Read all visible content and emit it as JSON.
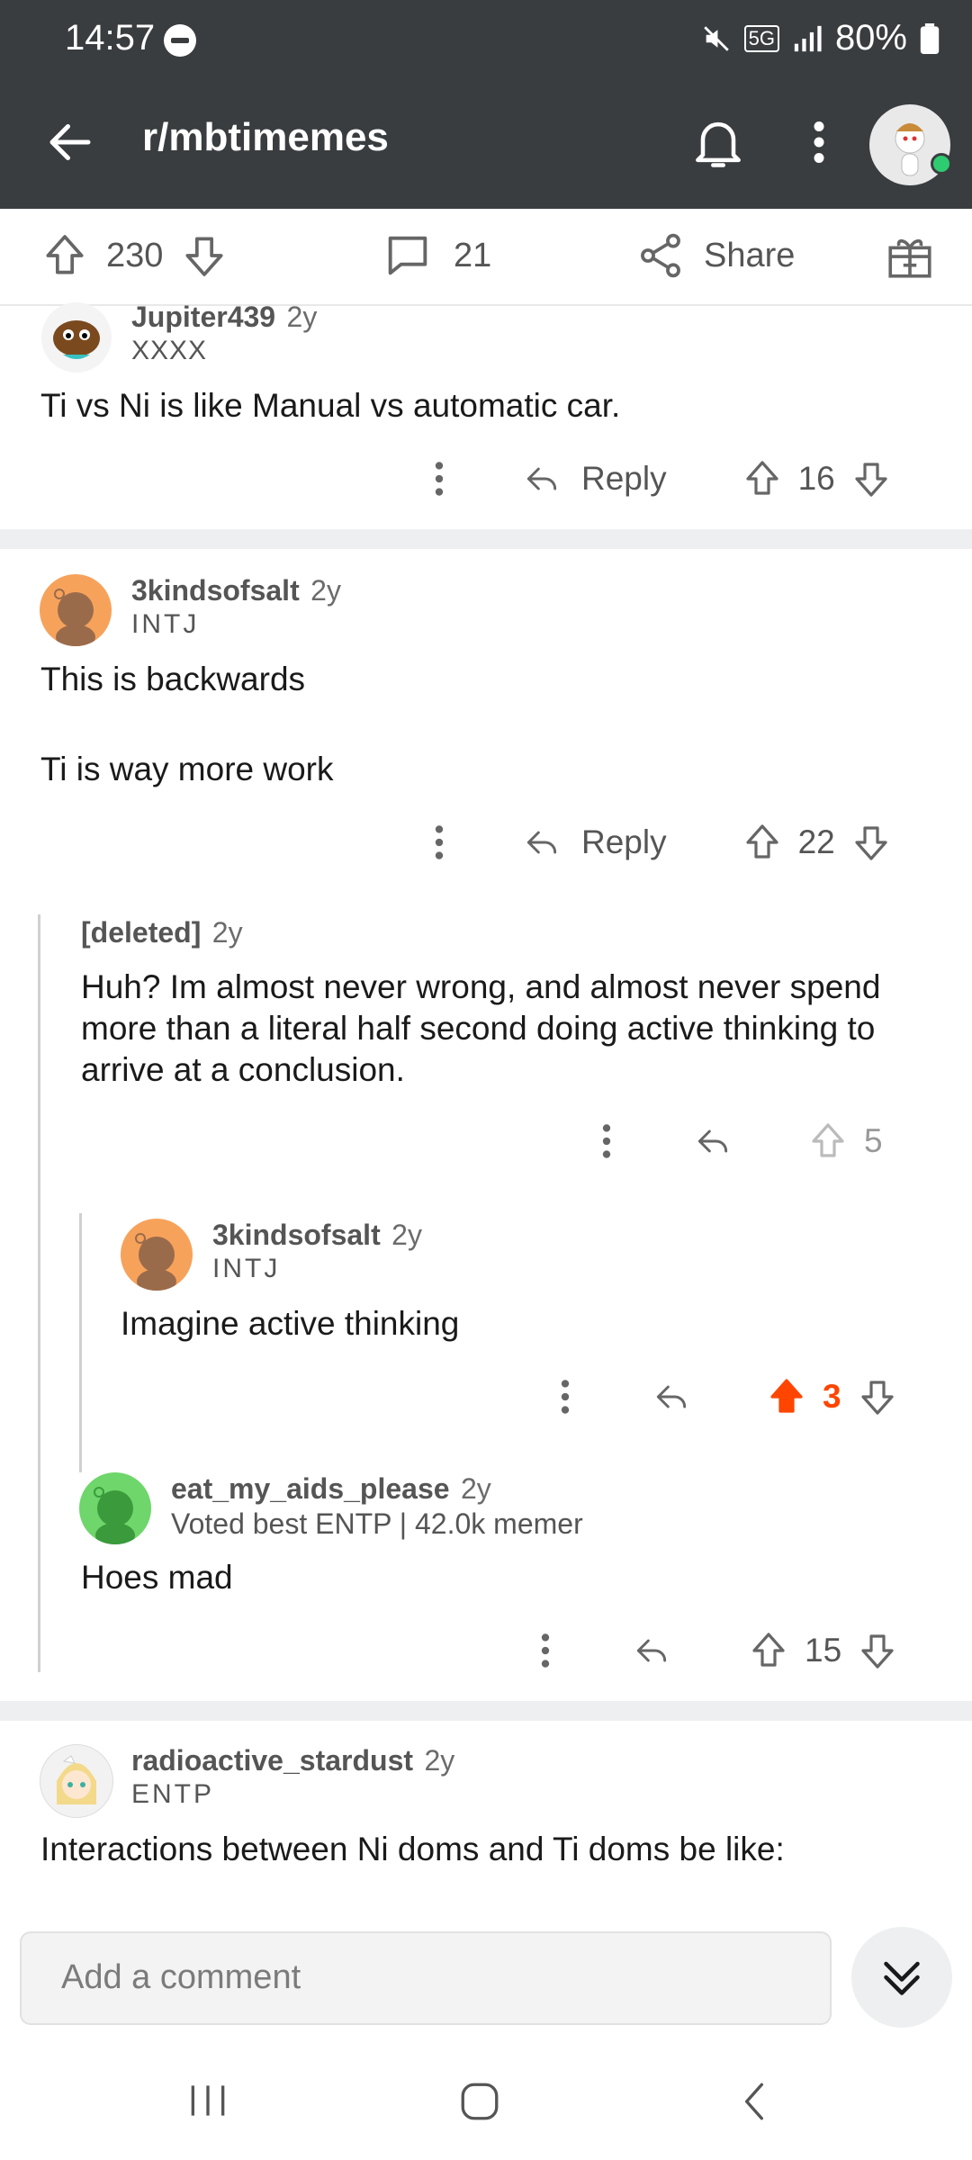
{
  "status": {
    "time": "14:57",
    "battery": "80%",
    "network": "5G"
  },
  "header": {
    "title": "r/mbtimemes"
  },
  "post_actions": {
    "upvotes": "230",
    "comments": "21",
    "share": "Share"
  },
  "comments": [
    {
      "username": "Jupiter439",
      "age": "2y",
      "flair": "XXXX",
      "body": [
        "Ti vs Ni is like Manual vs automatic car."
      ],
      "reply": "Reply",
      "score": "16"
    },
    {
      "username": "3kindsofsalt",
      "age": "2y",
      "flair": "INTJ",
      "body": [
        "This is backwards",
        "Ti is way more work"
      ],
      "reply": "Reply",
      "score": "22"
    },
    {
      "username": "[deleted]",
      "age": "2y",
      "flair": "",
      "body": [
        "Huh? Im almost never wrong, and almost never spend",
        "more than a literal half second doing active thinking to",
        "arrive at a conclusion."
      ],
      "score": "5"
    },
    {
      "username": "3kindsofsalt",
      "age": "2y",
      "flair": "INTJ",
      "body": [
        "Imagine active thinking"
      ],
      "score": "3",
      "upvoted": true
    },
    {
      "username": "eat_my_aids_please",
      "age": "2y",
      "flair": "Voted best ENTP | 42.0k memer",
      "body": [
        "Hoes mad"
      ],
      "score": "15"
    },
    {
      "username": "radioactive_stardust",
      "age": "2y",
      "flair": "ENTP",
      "body": [
        "Interactions between Ni doms and Ti doms be like:"
      ]
    }
  ],
  "composer": {
    "placeholder": "Add a comment"
  },
  "colors": {
    "header_bg": "#3a3d40",
    "upvote_active": "#ff4500",
    "separator": "#edeff1"
  }
}
